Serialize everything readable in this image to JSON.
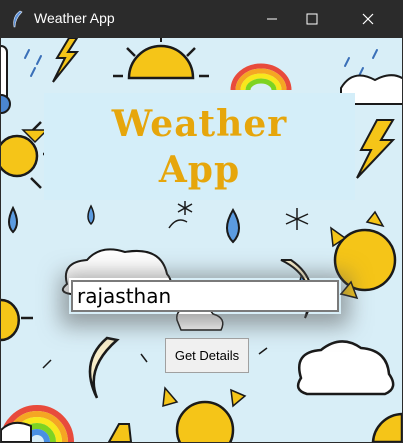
{
  "window": {
    "title": "Weather App",
    "controls": {
      "minimize": "minimize",
      "maximize": "maximize",
      "close": "close"
    }
  },
  "header": {
    "line1": "Weather",
    "line2": "App"
  },
  "search": {
    "value": "rajasthan",
    "placeholder": ""
  },
  "actions": {
    "get_details_label": "Get Details"
  },
  "icons": [
    "feather-icon",
    "sun-icon",
    "rainbow-icon",
    "lightning-icon",
    "raindrop-icon",
    "cloud-icon",
    "moon-icon",
    "snowflake-icon",
    "umbrella-icon",
    "thermometer-icon"
  ],
  "colors": {
    "titlebar": "#2b2b2b",
    "background": "#d8eef7",
    "title_panel": "#d4eef9",
    "title_text": "#e6a60c",
    "sun": "#f5c518",
    "sun_outline": "#1a1a1a"
  }
}
